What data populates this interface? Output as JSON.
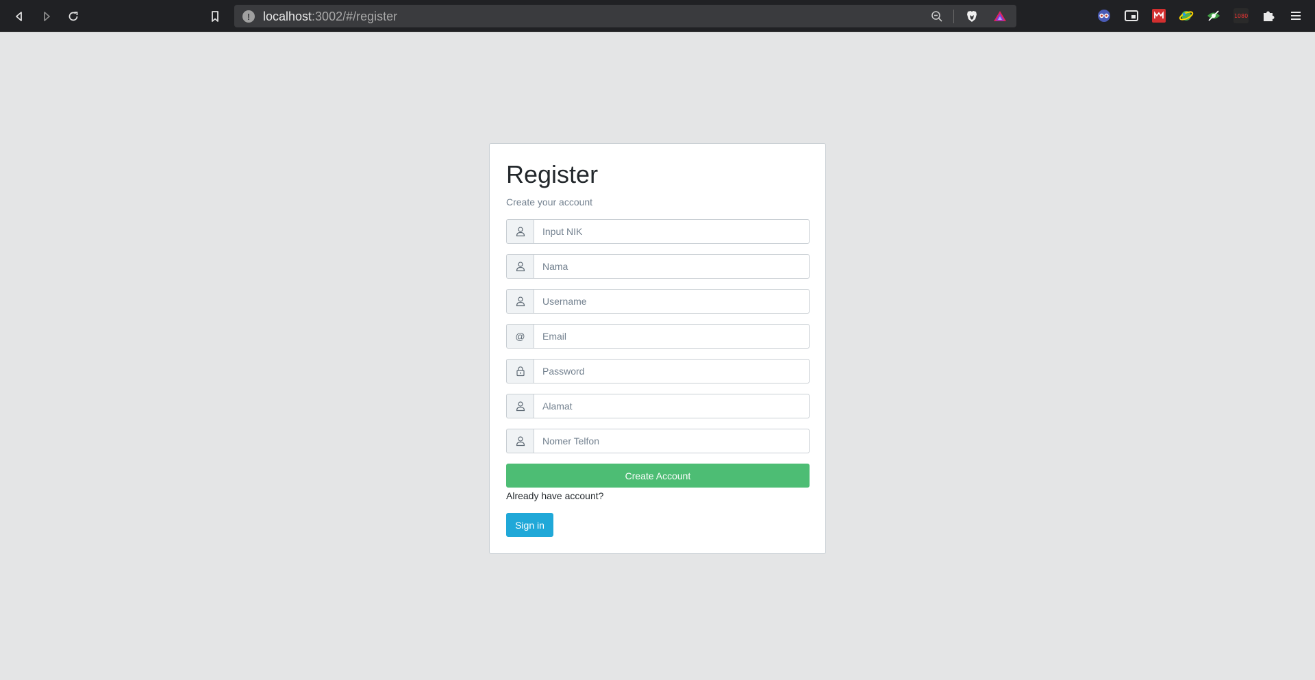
{
  "browser": {
    "url_host": "localhost",
    "url_path": ":3002/#/register",
    "ext_badge": "1080"
  },
  "register": {
    "title": "Register",
    "subtitle": "Create your account",
    "fields": [
      {
        "icon": "user-icon",
        "placeholder": "Input NIK"
      },
      {
        "icon": "user-icon",
        "placeholder": "Nama"
      },
      {
        "icon": "user-icon",
        "placeholder": "Username"
      },
      {
        "icon": "at-icon",
        "placeholder": "Email",
        "prefix": "@"
      },
      {
        "icon": "lock-icon",
        "placeholder": "Password"
      },
      {
        "icon": "user-icon",
        "placeholder": "Alamat"
      },
      {
        "icon": "user-icon",
        "placeholder": "Nomer Telfon"
      }
    ],
    "create_label": "Create Account",
    "already_text": "Already have account?",
    "signin_label": "Sign in"
  },
  "colors": {
    "background": "#e4e5e6",
    "success": "#4dbd74",
    "info": "#20a8d8"
  }
}
